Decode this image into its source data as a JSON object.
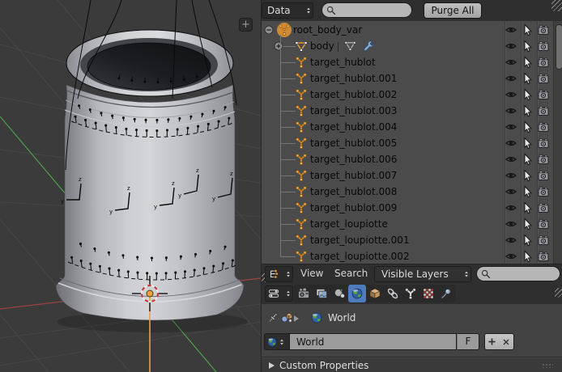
{
  "viewport": {
    "plus_button_label": "+",
    "gizmo_labels": {
      "horizontal": "y",
      "vertical": "z"
    },
    "colors": {
      "background": "#3b3b3b",
      "grid": "#474747",
      "x_axis": "#a04343",
      "y_axis": "#4f9e4f",
      "selected_bone_line": "#e8a33c",
      "cursor_ring_red": "#c33d3d"
    }
  },
  "outliner_data_header": {
    "mode_value": "Data",
    "search_placeholder": "",
    "purge_button_label": "Purge All"
  },
  "tree": {
    "items": [
      {
        "label": "root_body_var",
        "type": "root"
      },
      {
        "label": "body",
        "type": "mesh"
      },
      {
        "label": "target_hublot",
        "type": "empty"
      },
      {
        "label": "target_hublot.001",
        "type": "empty"
      },
      {
        "label": "target_hublot.002",
        "type": "empty"
      },
      {
        "label": "target_hublot.003",
        "type": "empty"
      },
      {
        "label": "target_hublot.004",
        "type": "empty"
      },
      {
        "label": "target_hublot.005",
        "type": "empty"
      },
      {
        "label": "target_hublot.006",
        "type": "empty"
      },
      {
        "label": "target_hublot.007",
        "type": "empty"
      },
      {
        "label": "target_hublot.008",
        "type": "empty"
      },
      {
        "label": "target_hublot.009",
        "type": "empty"
      },
      {
        "label": "target_loupiotte",
        "type": "empty"
      },
      {
        "label": "target_loupiotte.001",
        "type": "empty"
      },
      {
        "label": "target_loupiotte.002",
        "type": "empty"
      }
    ],
    "row_toggle_icons": [
      "visibility-eye",
      "selectability-cursor",
      "renderability-camera"
    ]
  },
  "outliner_header": {
    "view_menu": "View",
    "search_menu": "Search",
    "display_mode": "Visible Layers",
    "search_placeholder": ""
  },
  "properties": {
    "tabs": [
      "render",
      "render-layers",
      "scene",
      "world",
      "object",
      "constraints",
      "object-data",
      "texture",
      "physics"
    ],
    "active_tab": "world",
    "breadcrumb_item": "World",
    "id_block": {
      "name_value": "World",
      "fake_user_label": "F"
    },
    "panels": [
      {
        "label": "Custom Properties",
        "collapsed": true
      }
    ]
  },
  "colors": {
    "active_tab_highlight": "#4d7dbf",
    "header_background": "#2f2f2f",
    "outliner_background": "#4b4b4b",
    "properties_background": "#434343"
  }
}
